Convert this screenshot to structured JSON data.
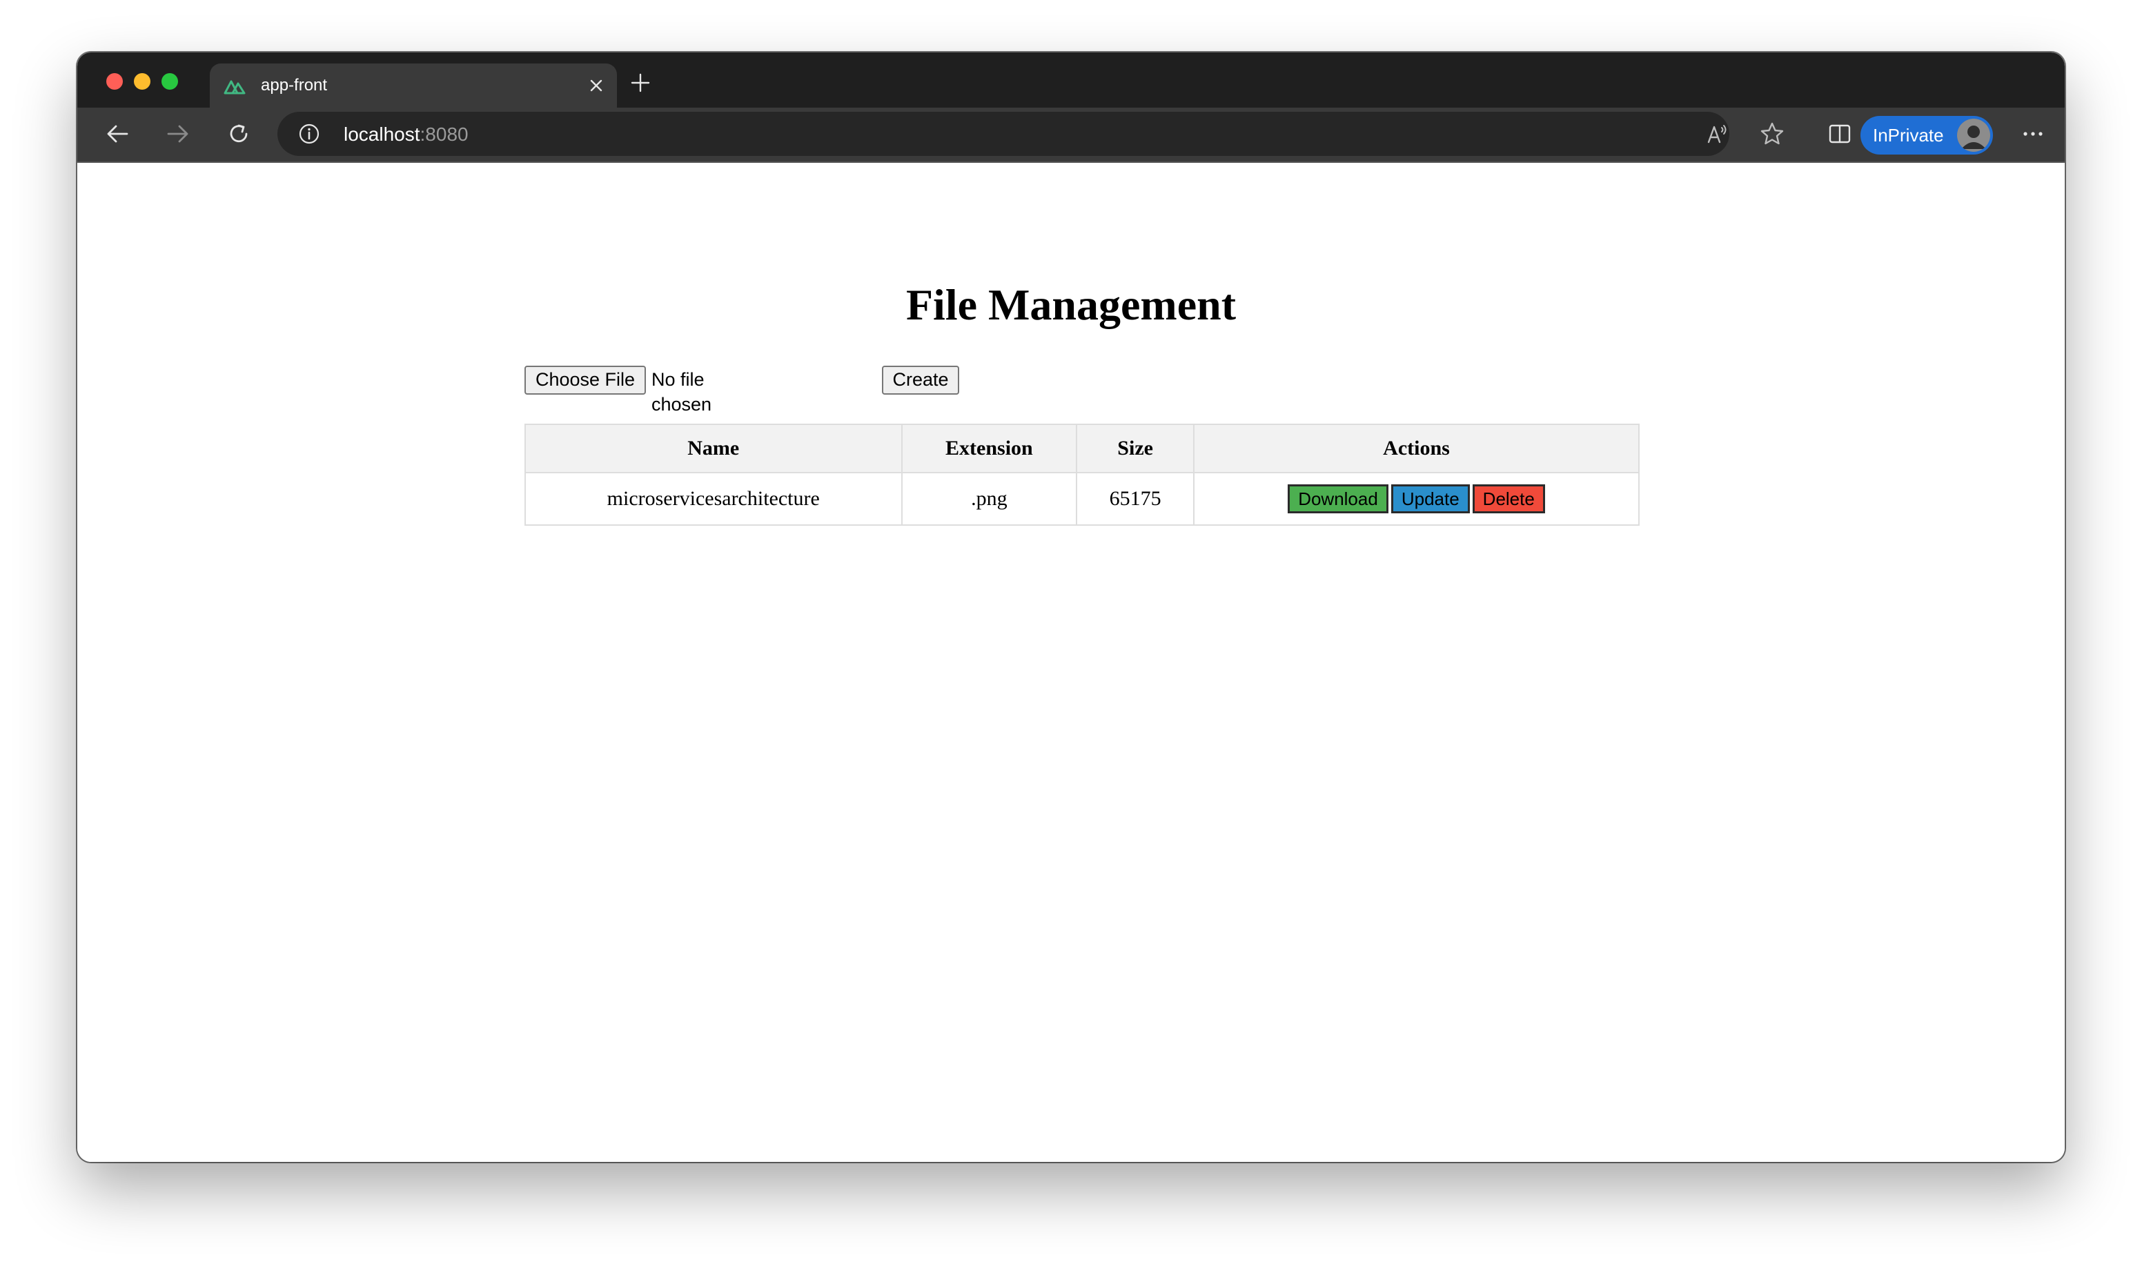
{
  "browser": {
    "tab_title": "app-front",
    "url_host": "localhost",
    "url_port": ":8080",
    "inprivate_label": "InPrivate"
  },
  "page": {
    "title": "File Management",
    "upload": {
      "choose_file_label": "Choose File",
      "no_file_text": "No file chosen",
      "create_label": "Create"
    },
    "table": {
      "headers": [
        "Name",
        "Extension",
        "Size",
        "Actions"
      ],
      "rows": [
        {
          "name": "microservicesarchitecture",
          "extension": ".png",
          "size": "65175"
        }
      ],
      "actions": {
        "download": "Download",
        "update": "Update",
        "delete": "Delete"
      }
    }
  },
  "colors": {
    "download": "#4caf50",
    "update": "#2a8fcc",
    "delete": "#f04a3a",
    "inprivate": "#1f6ed4"
  }
}
